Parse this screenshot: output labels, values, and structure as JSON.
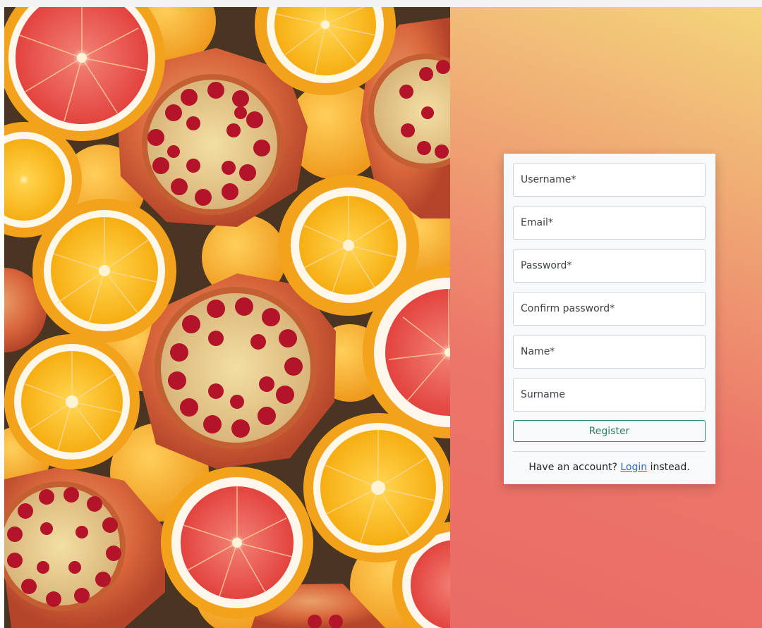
{
  "form": {
    "username_placeholder": "Username*",
    "email_placeholder": "Email*",
    "password_placeholder": "Password*",
    "confirm_password_placeholder": "Confirm password*",
    "name_placeholder": "Name*",
    "surname_placeholder": "Surname",
    "register_label": "Register",
    "login_prefix": "Have an account? ",
    "login_link": "Login",
    "login_suffix": " instead."
  },
  "colors": {
    "gradient_top": "#f4d57a",
    "gradient_bottom": "#ea6b66",
    "card_background": "#f8f9fa",
    "register_accent": "#2f7d59",
    "link": "#2a6bd1"
  }
}
